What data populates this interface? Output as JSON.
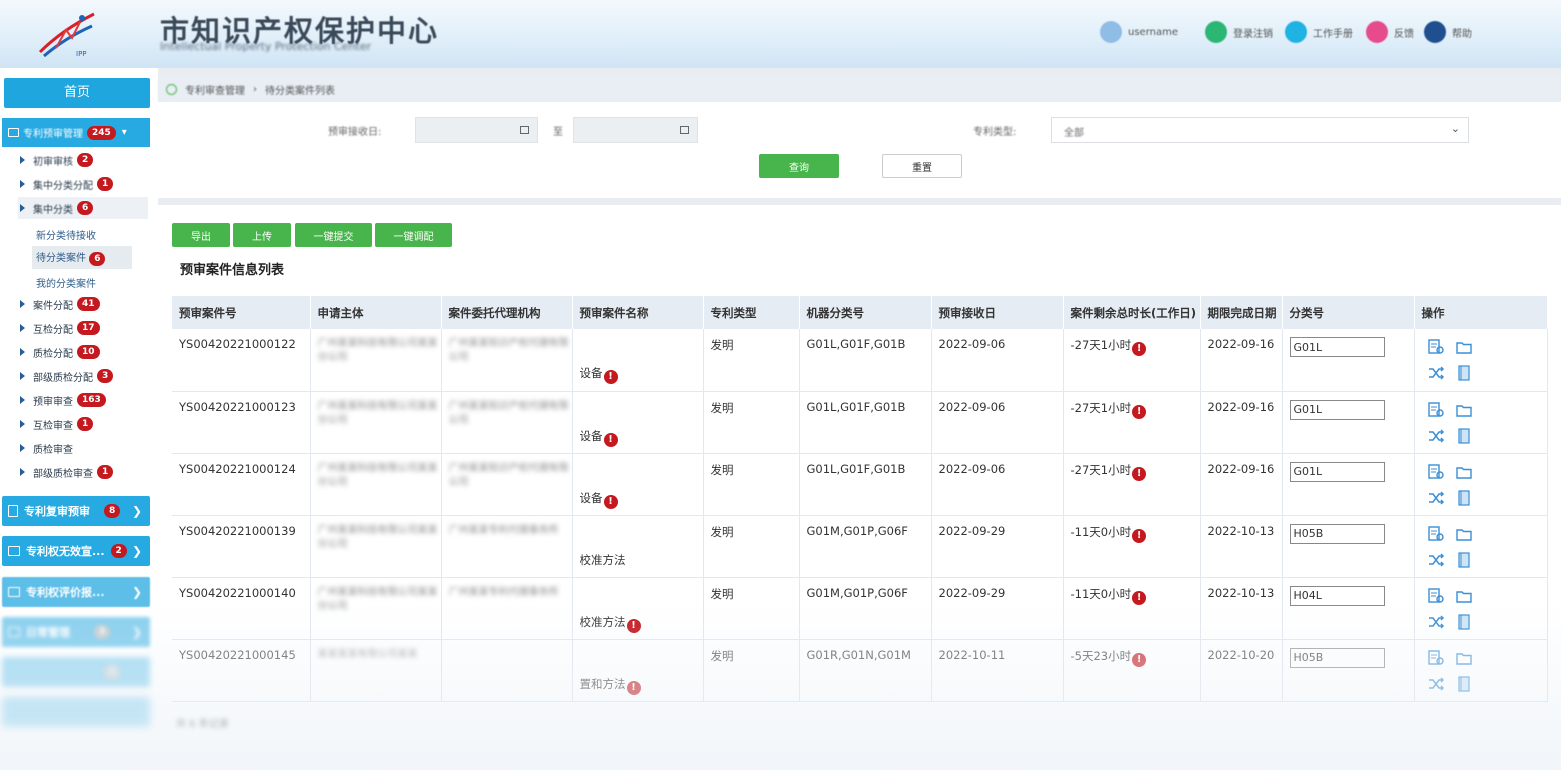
{
  "header": {
    "site_title": "市知识产权保护中心",
    "site_subtitle": "Intellectual Property Protection Center",
    "user_label": "username",
    "items": [
      "登录注销",
      "工作手册",
      "反馈",
      "帮助"
    ],
    "colors": {
      "green": "#2bb673",
      "cyan": "#1fb2e3",
      "pink": "#e64b8c",
      "navy": "#1f4f8f"
    }
  },
  "breadcrumb": [
    "专利审查管理",
    "待分类案件列表"
  ],
  "sidebar": {
    "top_label": "首页",
    "group": {
      "label": "专利预审管理",
      "badge": "245"
    },
    "items": [
      {
        "label": "初审审核",
        "badge": "2"
      },
      {
        "label": "集中分类分配",
        "badge": "1"
      },
      {
        "label": "集中分类",
        "badge": "6"
      }
    ],
    "subitems": [
      {
        "label": "新分类待接收",
        "badge": ""
      },
      {
        "label": "待分类案件",
        "badge": "6"
      },
      {
        "label": "我的分类案件",
        "badge": ""
      }
    ],
    "items2": [
      {
        "label": "案件分配",
        "badge": "41"
      },
      {
        "label": "互检分配",
        "badge": "17"
      },
      {
        "label": "质检分配",
        "badge": "10"
      },
      {
        "label": "部级质检分配",
        "badge": "3"
      },
      {
        "label": "预审审查",
        "badge": "163"
      },
      {
        "label": "互检审查",
        "badge": "1"
      },
      {
        "label": "质检审查",
        "badge": ""
      },
      {
        "label": "部级质检审查",
        "badge": "1"
      }
    ],
    "menus": [
      {
        "label": "专利复审预审",
        "badge": "8"
      },
      {
        "label": "专利权无效宣...",
        "badge": "2"
      },
      {
        "label": "专利权评价报...",
        "badge": ""
      },
      {
        "label": "日常管理",
        "badge": "3"
      },
      {
        "label": "",
        "badge": "1"
      },
      {
        "label": "",
        "badge": ""
      }
    ]
  },
  "filter": {
    "date_label": "预审接收日:",
    "to_label": "至",
    "type_label": "专利类型:",
    "type_value": "全部",
    "query_btn": "查询",
    "reset_btn": "重置"
  },
  "actions": {
    "export": "导出",
    "upload": "上传",
    "submit_all": "一键提交",
    "assign_all": "一键调配"
  },
  "list_title": "预审案件信息列表",
  "table": {
    "headers": [
      "预审案件号",
      "申请主体",
      "案件委托代理机构",
      "预审案件名称",
      "专利类型",
      "机器分类号",
      "预审接收日",
      "案件剩余总时长(工作日)",
      "期限完成日期",
      "分类号",
      "操作"
    ],
    "rows": [
      {
        "id": "YS00420221000122",
        "applicant": "广州某某科技有限公司某某分公司",
        "agency": "广州某某知识产权代理有限公司",
        "name": "设备",
        "warn_name": true,
        "type": "发明",
        "machine": "G01L,G01F,G01B",
        "received": "2022-09-06",
        "remaining": "-27天1小时",
        "deadline": "2022-09-16",
        "class": "G01L"
      },
      {
        "id": "YS00420221000123",
        "applicant": "广州某某科技有限公司某某分公司",
        "agency": "广州某某知识产权代理有限公司",
        "name": "设备",
        "warn_name": true,
        "type": "发明",
        "machine": "G01L,G01F,G01B",
        "received": "2022-09-06",
        "remaining": "-27天1小时",
        "deadline": "2022-09-16",
        "class": "G01L"
      },
      {
        "id": "YS00420221000124",
        "applicant": "广州某某科技有限公司某某分公司",
        "agency": "广州某某知识产权代理有限公司",
        "name": "设备",
        "warn_name": true,
        "type": "发明",
        "machine": "G01L,G01F,G01B",
        "received": "2022-09-06",
        "remaining": "-27天1小时",
        "deadline": "2022-09-16",
        "class": "G01L"
      },
      {
        "id": "YS00420221000139",
        "applicant": "广州某某科技有限公司某某分公司",
        "agency": "广州某某专利代理事务所",
        "name": "校准方法",
        "warn_name": false,
        "type": "发明",
        "machine": "G01M,G01P,G06F",
        "received": "2022-09-29",
        "remaining": "-11天0小时",
        "deadline": "2022-10-13",
        "class": "H05B"
      },
      {
        "id": "YS00420221000140",
        "applicant": "广州某某科技有限公司某某分公司",
        "agency": "广州某某专利代理事务所",
        "name": "校准方法",
        "warn_name": true,
        "type": "发明",
        "machine": "G01M,G01P,G06F",
        "received": "2022-09-29",
        "remaining": "-11天0小时",
        "deadline": "2022-10-13",
        "class": "H04L"
      },
      {
        "id": "YS00420221000145",
        "applicant": "某某某某有限公司某某",
        "agency": "",
        "name": "置和方法",
        "warn_name": true,
        "type": "发明",
        "machine": "G01R,G01N,G01M",
        "received": "2022-10-11",
        "remaining": "-5天23小时",
        "deadline": "2022-10-20",
        "class": "H05B"
      }
    ]
  },
  "footer_text": "共 6 条记录"
}
